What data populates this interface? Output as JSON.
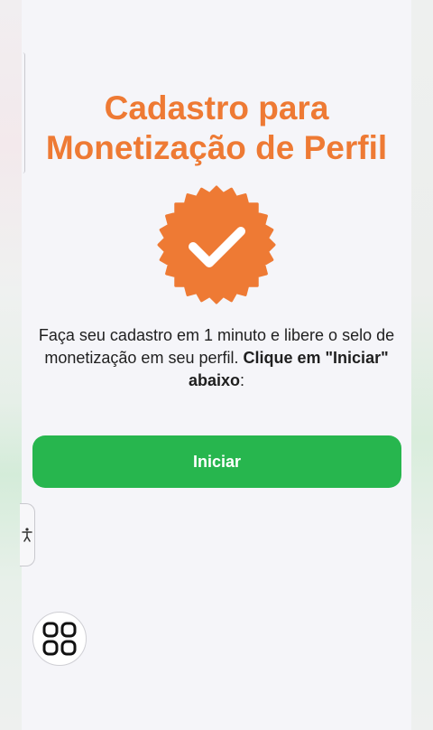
{
  "title_line1": "Cadastro para",
  "title_line2": "Monetização de Perfil",
  "badge_icon": "verified-badge-icon",
  "description": {
    "text": "Faça seu cadastro em 1 minuto e libere o selo de monetização em seu perfil.",
    "bold": "Clique em \"Iniciar\" abaixo",
    "suffix": ":"
  },
  "start_button_label": "Iniciar",
  "accessibility_icon": "accessibility-icon",
  "apps_icon": "apps-grid-icon",
  "colors": {
    "accent_orange": "#ee7a34",
    "button_green": "#27b64e",
    "background": "#f5f5f9"
  }
}
